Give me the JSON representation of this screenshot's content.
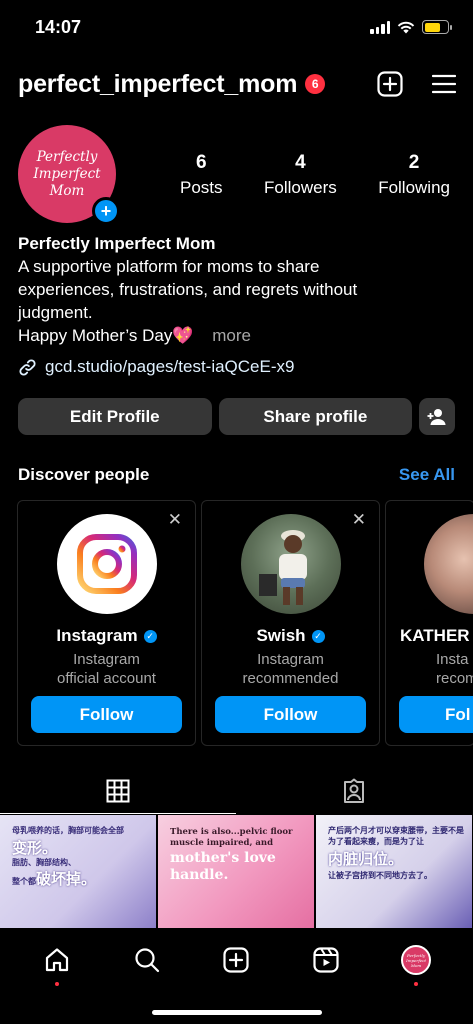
{
  "status_bar": {
    "time": "14:07"
  },
  "header": {
    "username": "perfect_imperfect_mom",
    "notification_count": "6"
  },
  "profile": {
    "avatar_text": [
      "Perfectly",
      "Imperfect",
      "Mom"
    ],
    "stats": [
      {
        "num": "6",
        "label": "Posts"
      },
      {
        "num": "4",
        "label": "Followers"
      },
      {
        "num": "2",
        "label": "Following"
      }
    ],
    "name": "Perfectly Imperfect Mom",
    "bio_lines": [
      "A supportive platform for moms to share",
      "experiences, frustrations, and regrets without",
      "judgment."
    ],
    "bio_last": "Happy Mother’s Day💖",
    "more": "more",
    "link": "gcd.studio/pages/test-iaQCeE-x9"
  },
  "buttons": {
    "edit": "Edit Profile",
    "share": "Share profile"
  },
  "discover": {
    "title": "Discover people",
    "see_all": "See All",
    "cards": [
      {
        "name": "Instagram",
        "sub1": "Instagram",
        "sub2": "official account",
        "follow": "Follow"
      },
      {
        "name": "Swish",
        "sub1": "Instagram",
        "sub2": "recommended",
        "follow": "Follow"
      },
      {
        "name": "KATHER",
        "sub1": "Insta",
        "sub2": "recomm",
        "follow": "Fol"
      }
    ]
  },
  "posts": [
    {
      "line1": "母乳喂养的话，胸部可能会全部",
      "big1": "变形。",
      "line2": "脂肪、胸部结构、",
      "line3": "整个都",
      "big2": "破坏掉。"
    },
    {
      "line1": "There is also...pelvic floor muscle impaired, and",
      "big": "mother's love handle."
    },
    {
      "line1": "产后两个月才可以穿束腰带，主要不是为了看起来瘦，而是为了让",
      "big": "内脏归位。",
      "line2": "让被子宫挤到不同地方去了。"
    }
  ],
  "colors": {
    "accent": "#0095f6",
    "badge": "#ff3040",
    "avatar_bg": "#d93a66"
  }
}
